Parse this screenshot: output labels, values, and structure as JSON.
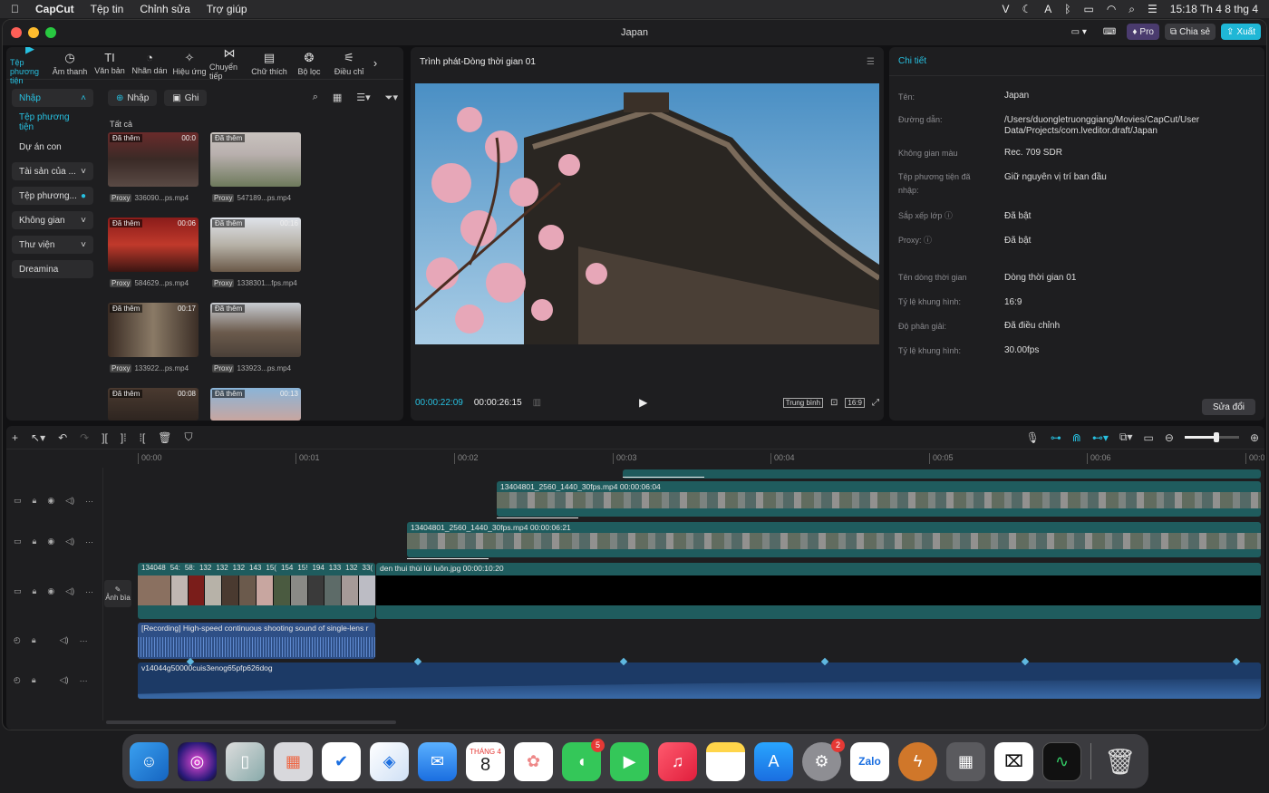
{
  "menubar": {
    "app": "CapCut",
    "items": [
      "Tệp tin",
      "Chỉnh sửa",
      "Trợ giúp"
    ],
    "clock": "15:18 Th 4 8 thg 4"
  },
  "window": {
    "title": "Japan",
    "pro": "Pro",
    "share": "Chia sẻ",
    "export": "Xuất"
  },
  "toolbar": [
    "Tệp phương tiện",
    "Âm thanh",
    "Văn bản",
    "Nhãn dán",
    "Hiệu ứng",
    "Chuyển tiếp",
    "Chữ thích",
    "Bộ lọc",
    "Điều chỉ"
  ],
  "sidebar": [
    "Nhập",
    "Tệp phương tiện",
    "Dự án con",
    "Tài sản của ...",
    "Tệp phương...",
    "Không gian",
    "Thư viện",
    "Dreamina"
  ],
  "media": {
    "import": "Nhập",
    "record": "Ghi",
    "all": "Tất cả",
    "badge": "Đã thêm",
    "proxy": "Proxy",
    "items": [
      {
        "name": "336090...ps.mp4",
        "dur": "00:0"
      },
      {
        "name": "547189...ps.mp4",
        "dur": ""
      },
      {
        "name": "584629...ps.mp4",
        "dur": "00:06"
      },
      {
        "name": "1338301...fps.mp4",
        "dur": "00:16"
      },
      {
        "name": "133922...ps.mp4",
        "dur": "00:17"
      },
      {
        "name": "133923...ps.mp4",
        "dur": ""
      },
      {
        "name": "",
        "dur": "00:08"
      },
      {
        "name": "",
        "dur": "00:13"
      }
    ]
  },
  "preview": {
    "title": "Trình phát-Dòng thời gian 01",
    "current": "00:00:22:09",
    "total": "00:00:26:15",
    "quality": "Trung bình",
    "ratio": "16:9"
  },
  "details": {
    "title": "Chi tiết",
    "edit": "Sửa đổi",
    "rows": [
      {
        "k": "Tên:",
        "v": "Japan"
      },
      {
        "k": "Đường dẫn:",
        "v": "/Users/duongletruonggiang/Movies/CapCut/User Data/Projects/com.lveditor.draft/Japan"
      },
      {
        "k": "Không gian màu",
        "v": "Rec. 709 SDR"
      },
      {
        "k": "Tệp phương tiện đã nhập:",
        "v": "Giữ nguyên vị trí ban đầu"
      },
      {
        "k": "Sắp xếp lớp ⓘ",
        "v": "Đã bật"
      },
      {
        "k": "Proxy: ⓘ",
        "v": "Đã bật"
      },
      {
        "k": "Tên dòng thời gian",
        "v": "Dòng thời gian 01"
      },
      {
        "k": "Tỷ lệ khung hình:",
        "v": "16:9"
      },
      {
        "k": "Độ phân giải:",
        "v": "Đã điều chỉnh"
      },
      {
        "k": "Tỷ lệ khung hình:",
        "v": "30.00fps"
      }
    ]
  },
  "timeline": {
    "ticks": [
      "00:00",
      "00:01",
      "00:02",
      "00:03",
      "00:04",
      "00:05",
      "00:06",
      "00:0"
    ],
    "cover": "Ảnh bìa",
    "clip1": "13404801_2560_1440_30fps.mp4   00:00:06:04",
    "clip2": "13404801_2560_1440_30fps.mp4   00:00:06:21",
    "clip3": "den thui thùi lùi luôn.jpg   00:00:10:20",
    "mini": [
      "134048",
      "54:",
      "58:",
      "132",
      "132",
      "132",
      "143",
      "15(",
      "154",
      "15!",
      "194",
      "133",
      "132",
      "33("
    ],
    "audio1": "[Recording] High-speed continuous shooting sound of single-lens r",
    "audio2": "v14044g50000cuis3enog65pfp626dog"
  },
  "dock": {
    "calendar_month": "THÁNG 4",
    "calendar_day": "8",
    "messages_badge": "5",
    "settings_badge": "2",
    "zalo": "Zalo"
  }
}
